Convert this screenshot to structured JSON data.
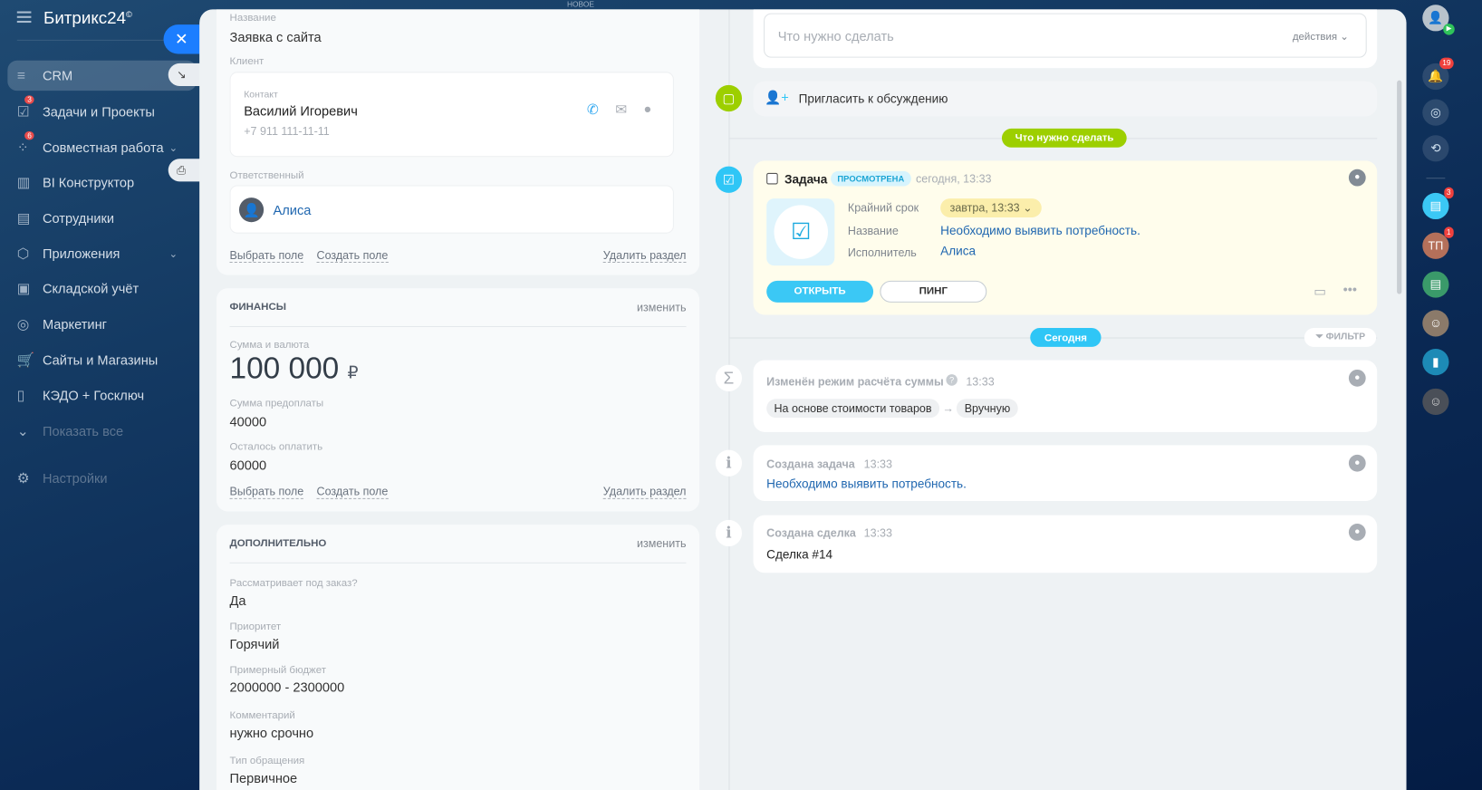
{
  "app": {
    "title": "Битрикс24",
    "mark": "©",
    "top_label": "НОВОЕ"
  },
  "sidebar": {
    "items": [
      {
        "label": "CRM",
        "icon": "funnel-icon",
        "glyph": "≡"
      },
      {
        "label": "Задачи и Проекты",
        "icon": "tasks-icon",
        "glyph": "☑",
        "badge": "3"
      },
      {
        "label": "Совместная работа",
        "icon": "collab-icon",
        "glyph": "⁘",
        "badge": "6",
        "chevron": "⌄"
      },
      {
        "label": "BI Конструктор",
        "icon": "chart-icon",
        "glyph": "▥"
      },
      {
        "label": "Сотрудники",
        "icon": "employees-icon",
        "glyph": "▤"
      },
      {
        "label": "Приложения",
        "icon": "apps-icon",
        "glyph": "⬡",
        "chevron": "⌄"
      },
      {
        "label": "Складской учёт",
        "icon": "warehouse-icon",
        "glyph": "▣"
      },
      {
        "label": "Маркетинг",
        "icon": "marketing-icon",
        "glyph": "◎"
      },
      {
        "label": "Сайты и Магазины",
        "icon": "cart-icon",
        "glyph": "🛒"
      },
      {
        "label": "КЭДО + Госключ",
        "icon": "document-icon",
        "glyph": "▯"
      },
      {
        "label": "Показать все",
        "icon": "chevron-down-icon",
        "glyph": "⌄"
      },
      {
        "label": "Настройки",
        "icon": "gear-icon",
        "glyph": "⚙"
      }
    ]
  },
  "left": {
    "name_label": "Название",
    "name_value": "Заявка с сайта",
    "client_label": "Клиент",
    "contact_label": "Контакт",
    "contact_name": "Василий Игоревич",
    "contact_phone": "+7 911 111-11-11",
    "responsible_label": "Ответственный",
    "responsible_name": "Алиса",
    "select_field": "Выбрать поле",
    "create_field": "Создать поле",
    "delete_section": "Удалить раздел",
    "finance": {
      "title": "ФИНАНСЫ",
      "edit": "изменить",
      "sum_label": "Сумма и валюта",
      "sum_value": "100 000",
      "currency": "₽",
      "prepay_label": "Сумма предоплаты",
      "prepay_value": "40000",
      "rest_label": "Осталось оплатить",
      "rest_value": "60000"
    },
    "extra": {
      "title": "ДОПОЛНИТЕЛЬНО",
      "edit": "изменить",
      "fields": [
        {
          "label": "Рассматривает под заказ?",
          "value": "Да"
        },
        {
          "label": "Приоритет",
          "value": "Горячий"
        },
        {
          "label": "Примерный бюджет",
          "value": "2000000 - 2300000"
        },
        {
          "label": "Комментарий",
          "value": "нужно срочно"
        },
        {
          "label": "Тип обращения",
          "value": "Первичное"
        }
      ]
    }
  },
  "timeline": {
    "todo_placeholder": "Что нужно сделать",
    "actions": "действия",
    "invite": "Пригласить к обсуждению",
    "todo_pill": "Что нужно сделать",
    "task": {
      "title": "Задача",
      "status": "ПРОСМОТРЕНА",
      "time": "сегодня, 13:33",
      "deadline_label": "Крайний срок",
      "deadline": "завтра, 13:33",
      "name_label": "Название",
      "name": "Необходимо выявить потребность.",
      "assignee_label": "Исполнитель",
      "assignee": "Алиса",
      "open": "ОТКРЫТЬ",
      "ping": "ПИНГ"
    },
    "today_pill": "Сегодня",
    "filter": "ФИЛЬТР",
    "events": [
      {
        "title": "Изменён режим расчёта суммы",
        "time": "13:33",
        "from": "На основе стоимости товаров",
        "to": "Вручную"
      },
      {
        "title": "Создана задача",
        "time": "13:33",
        "body": "Необходимо выявить потребность."
      },
      {
        "title": "Создана сделка",
        "time": "13:33",
        "body": "Сделка #14"
      }
    ]
  },
  "rail": {
    "bell_badge": "19",
    "chat_badge": "3",
    "tp_initials": "ТП",
    "tp_badge": "1"
  },
  "colors": {
    "accent": "#2fc6f6",
    "green": "#9dcf00",
    "link": "#2067b0",
    "close": "#1c7eff"
  }
}
